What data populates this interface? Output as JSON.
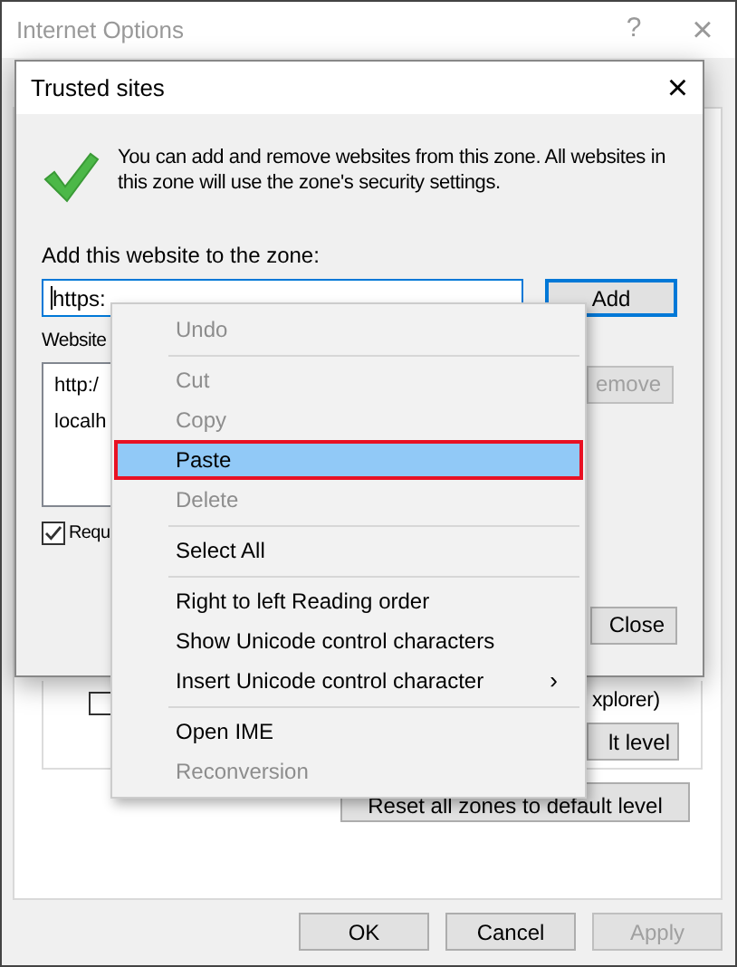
{
  "window": {
    "title": "Internet Options",
    "help": "?",
    "close": "×"
  },
  "background": {
    "checkbox": {
      "checked": false
    },
    "checkbox_label": "xplorer)",
    "zone_button": "lt level",
    "reset_button": "Reset all zones to default level"
  },
  "buttons": [
    {
      "label": "OK",
      "disabled": false
    },
    {
      "label": "Cancel",
      "disabled": false
    },
    {
      "label": "Apply",
      "disabled": true
    }
  ],
  "dialog": {
    "title": "Trusted sites",
    "close": "×",
    "message": "You can add and remove websites from this zone. All websites in this zone will use the zone's security settings.",
    "add_label": "Add this website to the zone:",
    "add_value": "https:",
    "add_button": "Add",
    "websites_label": "Website",
    "websites": [
      "http:/",
      "localh"
    ],
    "remove_button": {
      "label": "emove",
      "disabled": true
    },
    "require_checkbox": {
      "label": "Requ",
      "checked": true
    },
    "close_button": "Close"
  },
  "context_menu": [
    {
      "kind": "item",
      "label": "Undo",
      "disabled": true,
      "selected": false
    },
    {
      "kind": "separator"
    },
    {
      "kind": "item",
      "label": "Cut",
      "disabled": true,
      "selected": false
    },
    {
      "kind": "item",
      "label": "Copy",
      "disabled": true,
      "selected": false
    },
    {
      "kind": "item",
      "label": "Paste",
      "disabled": false,
      "selected": true
    },
    {
      "kind": "item",
      "label": "Delete",
      "disabled": true,
      "selected": false
    },
    {
      "kind": "separator"
    },
    {
      "kind": "item",
      "label": "Select All",
      "disabled": false,
      "selected": false
    },
    {
      "kind": "separator"
    },
    {
      "kind": "item",
      "label": "Right to left Reading order",
      "disabled": false,
      "selected": false
    },
    {
      "kind": "item",
      "label": "Show Unicode control characters",
      "disabled": false,
      "selected": false
    },
    {
      "kind": "submenu",
      "label": "Insert Unicode control character",
      "arrow": "›",
      "disabled": false,
      "selected": false
    },
    {
      "kind": "separator"
    },
    {
      "kind": "item",
      "label": "Open IME",
      "disabled": false,
      "selected": false
    },
    {
      "kind": "item",
      "label": "Reconversion",
      "disabled": true,
      "selected": false
    }
  ]
}
